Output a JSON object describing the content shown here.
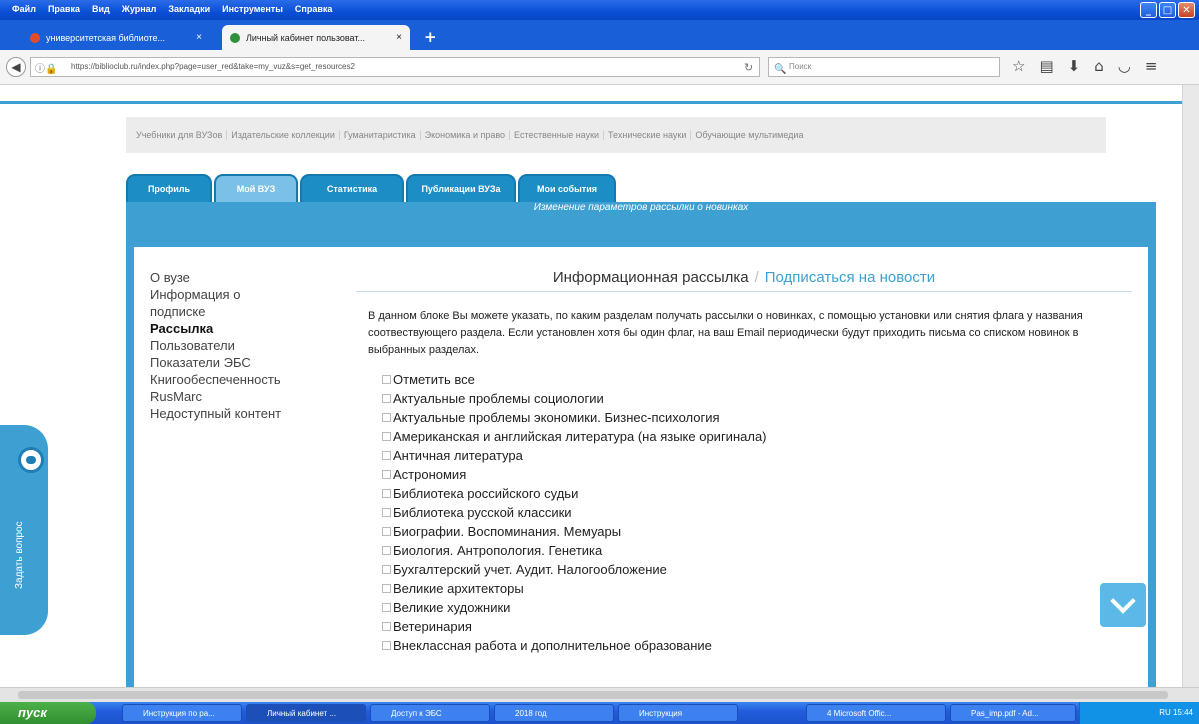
{
  "window": {
    "menu": [
      "Файл",
      "Правка",
      "Вид",
      "Журнал",
      "Закладки",
      "Инструменты",
      "Справка"
    ],
    "buttons": {
      "minimize": "_",
      "maximize": "□",
      "close": "✕"
    }
  },
  "browser": {
    "tabs": [
      {
        "label": "университетская библиоте...",
        "close": "×"
      },
      {
        "label": "Личный кабинет пользоват...",
        "close": "×"
      }
    ],
    "new_tab": "+",
    "url": "https://biblioclub.ru/index.php?page=user_red&take=my_vuz&s=get_resources2",
    "search_placeholder": "Поиск"
  },
  "site": {
    "categories": [
      "Учебники для ВУЗов",
      "Издательские коллекции",
      "Гуманитаристика",
      "Экономика и право",
      "Естественные науки",
      "Технические науки",
      "Обучающие мультимедиа"
    ],
    "profile_tabs": [
      "Профиль",
      "Мой ВУЗ",
      "Статистика",
      "Публикации ВУЗа",
      "Мои события"
    ],
    "panel_header": "Изменение параметров рассылки о новинках",
    "sidenav": [
      "О вузе",
      "Информация о",
      "подписке",
      "Рассылка",
      "Пользователи",
      "Показатели ЭБС",
      "Книгообеспеченность",
      "RusMarc",
      "Недоступный контент"
    ],
    "breadcrumb": {
      "current": "Информационная рассылка",
      "sep": "/",
      "link": "Подписаться на новости"
    },
    "description": "В данном блоке Вы можете указать, по каким разделам получать рассылки о новинках, с помощью установки или снятия флага у названия соотвествующего раздела. Если установлен хотя бы один флаг, на ваш Email периодически будут приходить письма со списком новинок в выбранных разделах.",
    "checkboxes": [
      "Отметить все",
      "Актуальные проблемы социологии",
      "Актуальные проблемы экономики. Бизнес-психология",
      "Американская и английская литература (на языке оригинала)",
      "Античная литература",
      "Астрономия",
      "Библиотека российского судьи",
      "Библиотека русской классики",
      "Биографии. Воспоминания. Мемуары",
      "Биология. Антропология. Генетика",
      "Бухгалтерский учет. Аудит. Налогообложение",
      "Великие архитекторы",
      "Великие художники",
      "Ветеринария",
      "Внеклассная работа и дополнительное образование"
    ],
    "ask_widget": "Задать вопрос"
  },
  "taskbar": {
    "start": "пуск",
    "tasks": [
      "Инструкция по ра...",
      "Личный кабинет ...",
      "Доступ к ЭБС",
      "2018 год",
      "Инструкция",
      "4 Microsoft Offic...",
      "Pas_imp.pdf - Ad..."
    ],
    "clock": "RU 15:44"
  }
}
